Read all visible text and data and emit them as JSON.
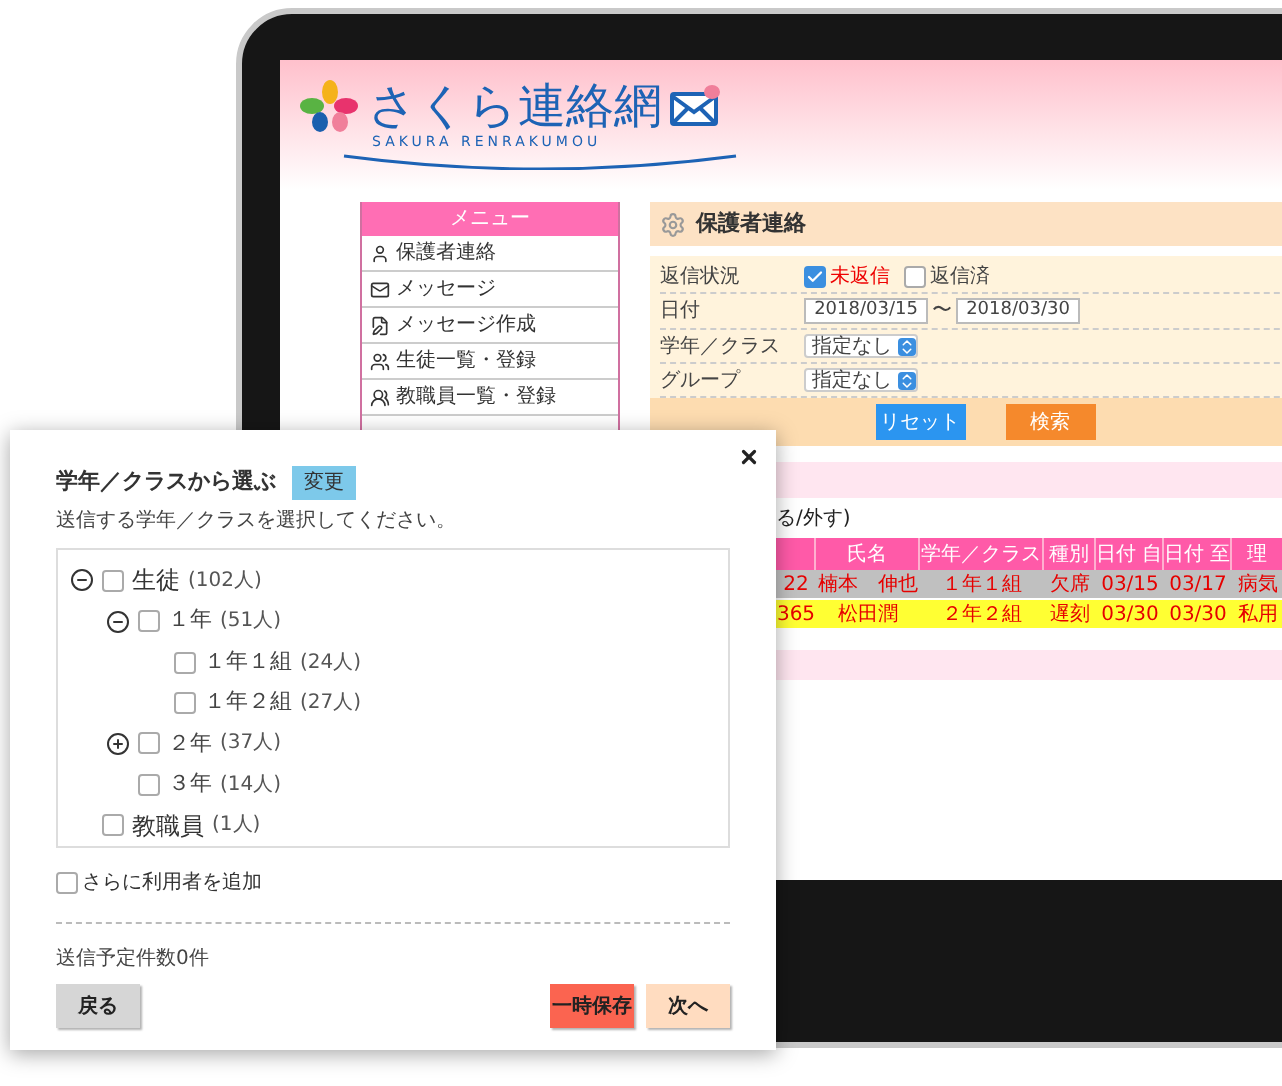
{
  "app": {
    "logo_title": "さくら連絡網",
    "logo_subtitle": "SAKURA RENRAKUMOU"
  },
  "menu": {
    "title": "メニュー",
    "items": [
      "保護者連絡",
      "メッセージ",
      "メッセージ作成",
      "生徒一覧・登録",
      "教職員一覧・登録"
    ]
  },
  "panel": {
    "title": "保護者連絡",
    "reply_status": {
      "label": "返信状況",
      "options": [
        {
          "label": "未返信",
          "checked": true
        },
        {
          "label": "返信済",
          "checked": false
        }
      ]
    },
    "date": {
      "label": "日付",
      "from": "2018/03/15",
      "separator": "〜",
      "to": "2018/03/30"
    },
    "class_select": {
      "label": "学年／クラス",
      "value": "指定なし"
    },
    "group_select": {
      "label": "グループ",
      "value": "指定なし"
    },
    "buttons": [
      {
        "label": "リセット",
        "kind": "reset"
      },
      {
        "label": "検索",
        "kind": "search"
      }
    ]
  },
  "table": {
    "note": "る/外す)",
    "columns": [
      "",
      "氏名",
      "学年／クラス",
      "種別",
      "日付 自",
      "日付 至",
      "理"
    ],
    "rows": [
      {
        "color": "#c0c0c0",
        "cells": [
          "22",
          "楠本　伸也",
          "１年１組",
          "欠席",
          "03/15",
          "03/17",
          "病気"
        ]
      },
      {
        "color": "#ffff33",
        "cells": [
          "365",
          "松田潤",
          "２年２組",
          "遅刻",
          "03/30",
          "03/30",
          "私用"
        ]
      }
    ]
  },
  "dialog": {
    "title": "学年／クラスから選ぶ",
    "change_button": "変更",
    "description": "送信する学年／クラスを選択してください。",
    "tree": [
      {
        "label": "生徒",
        "count": "(102人)",
        "checked": false,
        "expanded": true,
        "children": [
          {
            "label": "１年",
            "count": "(51人)",
            "checked": false,
            "expanded": true,
            "children": [
              {
                "label": "１年１組",
                "count": "(24人)",
                "checked": false
              },
              {
                "label": "１年２組",
                "count": "(27人)",
                "checked": false
              }
            ]
          },
          {
            "label": "２年",
            "count": "(37人)",
            "checked": false,
            "expanded": false
          },
          {
            "label": "３年",
            "count": "(14人)",
            "checked": false
          }
        ]
      },
      {
        "label": "教職員",
        "count": "(1人)",
        "checked": false
      }
    ],
    "add_users": {
      "label": "さらに利用者を追加",
      "checked": false
    },
    "scheduled_count": "送信予定件数0件",
    "buttons": [
      {
        "label": "戻る",
        "kind": "back"
      },
      {
        "label": "一時保存",
        "kind": "save"
      },
      {
        "label": "次へ",
        "kind": "next"
      }
    ]
  }
}
